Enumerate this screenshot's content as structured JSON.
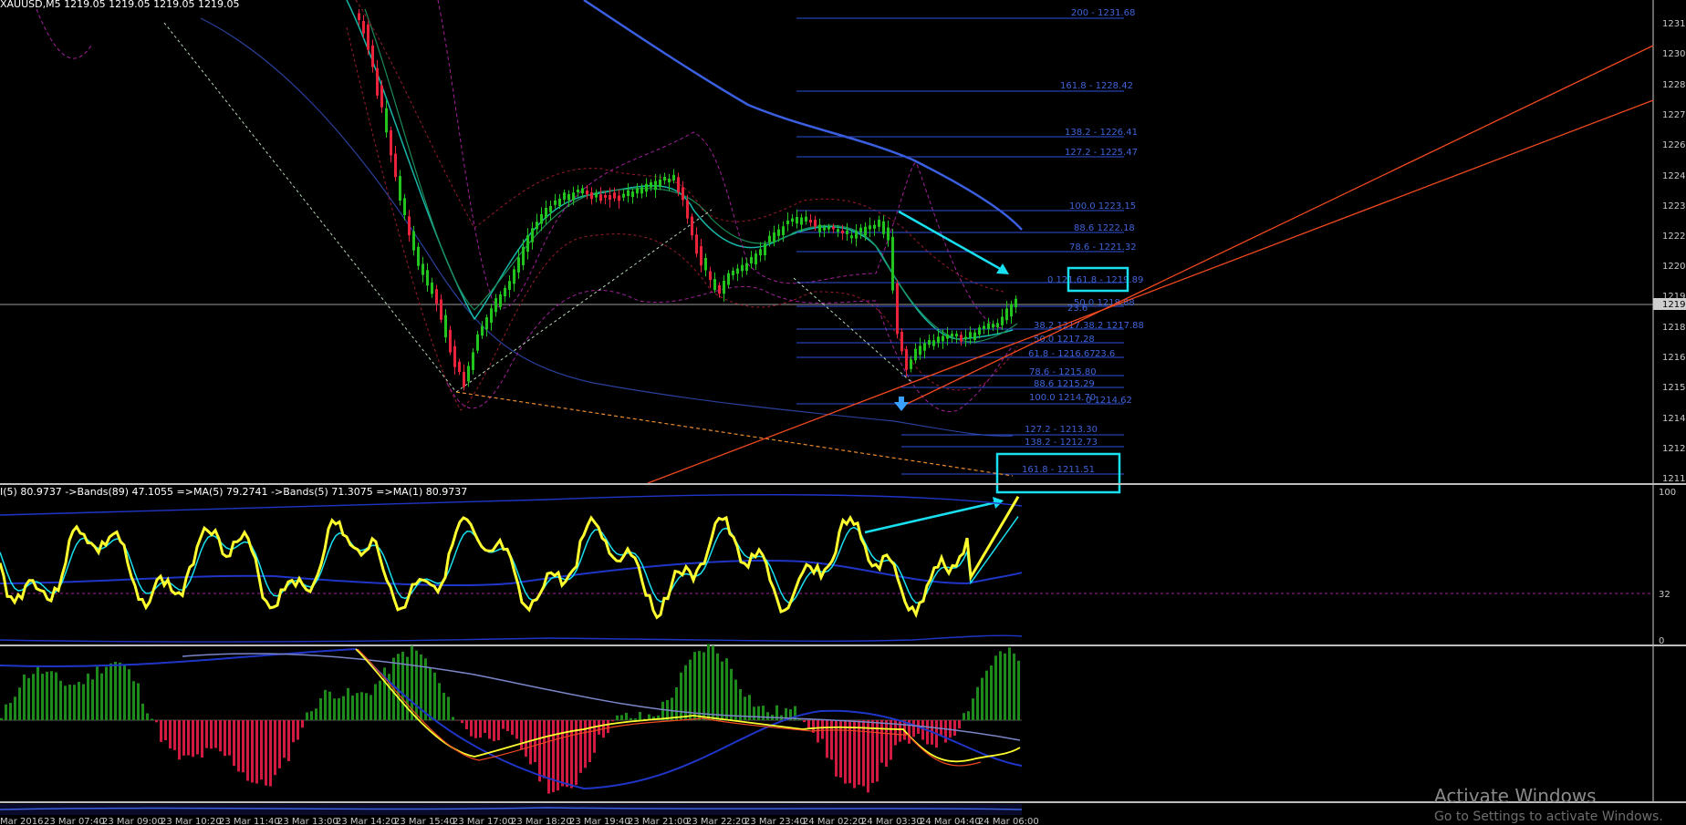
{
  "header": {
    "title": "XAUUSD,M5  1219.05 1219.05 1219.05 1219.05"
  },
  "oscillator_header": "I(5) 80.9737  ->Bands(89) 47.1055  =>MA(5) 79.2741  ->Bands(5) 71.3075  =>MA(1) 80.9737",
  "price_axis": [
    "1231.4",
    "1230.0",
    "1228.7",
    "1227.4",
    "1226.0",
    "1224.7",
    "1223.3",
    "1222.0",
    "1220.7",
    "1219.7",
    "1218.0",
    "1216.7",
    "1215.3",
    "1214.0",
    "1212.6",
    "1211.3"
  ],
  "current_price": "1219.0",
  "osc_axis": {
    "top": "100",
    "mid": "32",
    "bottom": "0"
  },
  "time_axis": [
    "Mar 2016",
    "23 Mar 07:40",
    "23 Mar 09:00",
    "23 Mar 10:20",
    "23 Mar 11:40",
    "23 Mar 13:00",
    "23 Mar 14:20",
    "23 Mar 15:40",
    "23 Mar 17:00",
    "23 Mar 18:20",
    "23 Mar 19:40",
    "23 Mar 21:00",
    "23 Mar 22:20",
    "23 Mar 23:40",
    "24 Mar 02:20",
    "24 Mar 03:30",
    "24 Mar 04:40",
    "24 Mar 06:00"
  ],
  "fib_upper": [
    "200 - 1231.68",
    "161.8 - 1228.42",
    "138.2 - 1226.41",
    "127.2 - 1225.47",
    "100.0 1223.15",
    "88.6 1222.18",
    "78.6 - 1221.32",
    "0 121.61.8 - 1219.89",
    "50.0 1218.88",
    "38.2 1217.38.2 1217.88",
    "50.0 1217.28",
    "61.8 - 1216.67",
    "78.6 - 1215.80",
    "88.6 1215.29",
    "100.0 1214.70",
    "0 1214.62",
    "127.2 - 1213.30",
    "138.2 - 1212.73",
    "161.8 - 1211.51"
  ],
  "fib_misc": [
    "23.6",
    "23.6"
  ],
  "watermark": {
    "line1": "Activate Windows",
    "line2": "Go to Settings to activate Windows."
  },
  "colors": {
    "bull": "#22c41e",
    "bear": "#e8233a",
    "fib": "#3050d8",
    "trend": "#f04820",
    "cyan": "#18e0f0",
    "osc_main": "#ffff30"
  }
}
